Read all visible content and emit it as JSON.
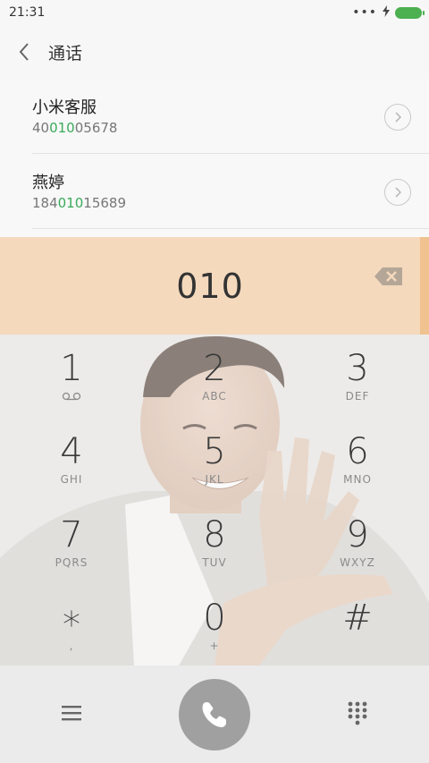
{
  "status_bar": {
    "time": "21:31",
    "indicators": [
      "more-dots-icon",
      "charging-bolt-icon",
      "battery-icon"
    ],
    "battery_color": "#4caf50"
  },
  "header": {
    "title": "通话",
    "back_icon": "chevron-left-icon"
  },
  "contacts": [
    {
      "name": "小米客服",
      "number_prefix": "40",
      "number_match": "010",
      "number_suffix": "05678"
    },
    {
      "name": "燕婷",
      "number_prefix": "184",
      "number_match": "010",
      "number_suffix": "15689"
    }
  ],
  "match_color": "#3aaa5a",
  "dialer": {
    "entered_digits": "010",
    "backspace_icon": "backspace-icon"
  },
  "keypad": {
    "keys": [
      {
        "digit": "1",
        "letters": "voicemail-icon"
      },
      {
        "digit": "2",
        "letters": "ABC"
      },
      {
        "digit": "3",
        "letters": "DEF"
      },
      {
        "digit": "4",
        "letters": "GHI"
      },
      {
        "digit": "5",
        "letters": "JKL"
      },
      {
        "digit": "6",
        "letters": "MNO"
      },
      {
        "digit": "7",
        "letters": "PQRS"
      },
      {
        "digit": "8",
        "letters": "TUV"
      },
      {
        "digit": "9",
        "letters": "WXYZ"
      },
      {
        "digit": "∗",
        "letters": ","
      },
      {
        "digit": "0",
        "letters": "+"
      },
      {
        "digit": "#",
        "letters": ""
      }
    ]
  },
  "bottom_bar": {
    "menu_icon": "menu-icon",
    "call_icon": "phone-icon",
    "dialpad_icon": "dialpad-icon",
    "call_button_color": "#a0a0a0"
  }
}
